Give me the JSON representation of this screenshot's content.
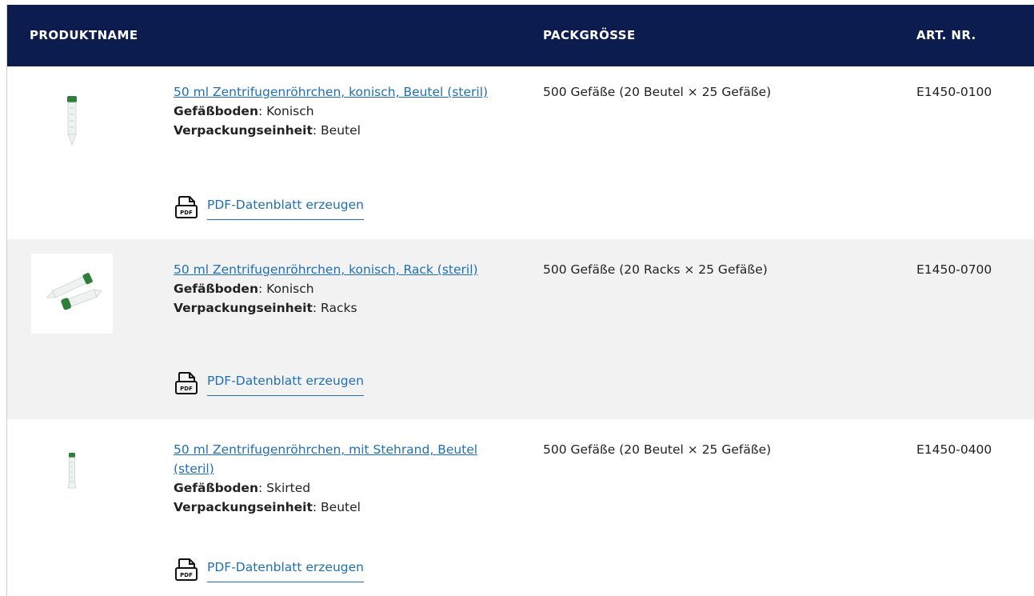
{
  "header": {
    "col_name": "PRODUKTNAME",
    "col_pack": "PACKGRÖSSE",
    "col_art": "ART. NR."
  },
  "rows": [
    {
      "product_name": "50 ml Zentrifugenröhrchen, konisch, Beutel (steril)",
      "spec1_label": "Gefäßboden",
      "spec1_value": ": Konisch",
      "spec2_label": "Verpackungseinheit",
      "spec2_value": ": Beutel",
      "pdf_label": "PDF-Datenblatt erzeugen",
      "pack_size": "500 Gefäße (20 Beutel × 25 Gefäße)",
      "art_nr": "E1450-0100",
      "image_icon": "upright-conical-tube-icon"
    },
    {
      "product_name": "50 ml Zentrifugenröhrchen, konisch, Rack (steril)",
      "spec1_label": "Gefäßboden",
      "spec1_value": ": Konisch",
      "spec2_label": "Verpackungseinheit",
      "spec2_value": ": Racks",
      "pdf_label": "PDF-Datenblatt erzeugen",
      "pack_size": "500 Gefäße (20 Racks × 25 Gefäße)",
      "art_nr": "E1450-0700",
      "image_icon": "two-tubes-lying-icon"
    },
    {
      "product_name": "50 ml Zentrifugenröhrchen, mit Stehrand, Beutel (steril)",
      "spec1_label": "Gefäßboden",
      "spec1_value": ": Skirted",
      "spec2_label": "Verpackungseinheit",
      "spec2_value": ": Beutel",
      "pdf_label": "PDF-Datenblatt erzeugen",
      "pack_size": "500 Gefäße (20 Beutel × 25 Gefäße)",
      "art_nr": "E1450-0400",
      "image_icon": "skirted-tube-icon"
    }
  ],
  "colors": {
    "header_bg": "#0d1c4f",
    "link": "#1f6fb5",
    "alt_row": "#f2f2f2",
    "cap_green": "#2f7d3a"
  }
}
